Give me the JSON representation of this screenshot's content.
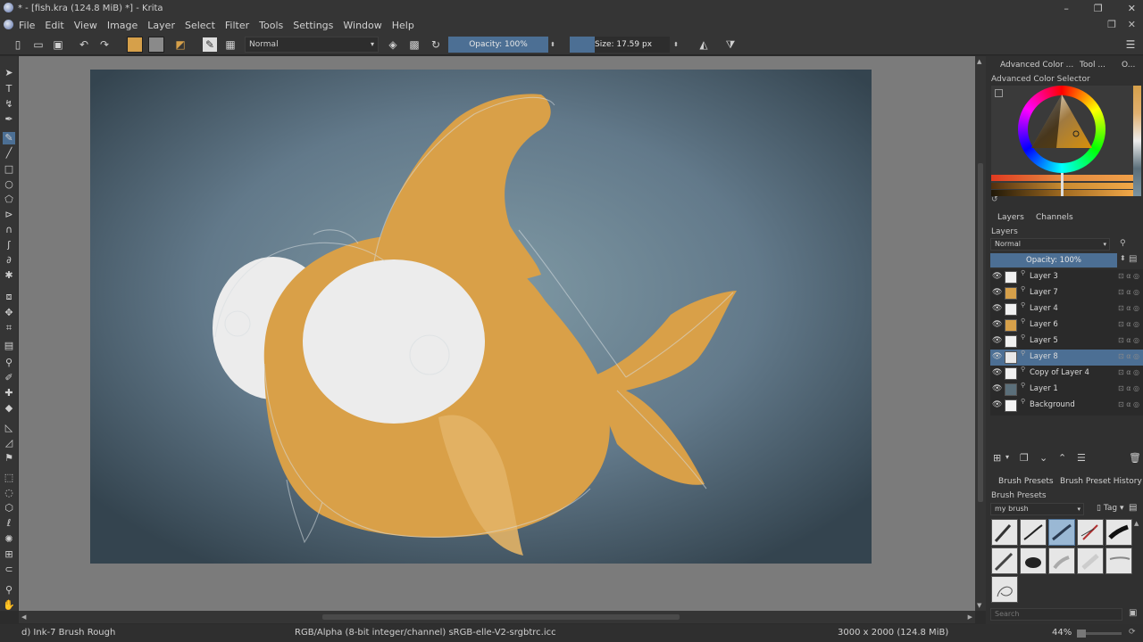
{
  "window": {
    "title": "* - [fish.kra (124.8 MiB) *] - Krita"
  },
  "menu": [
    "File",
    "Edit",
    "View",
    "Image",
    "Layer",
    "Select",
    "Filter",
    "Tools",
    "Settings",
    "Window",
    "Help"
  ],
  "toolbar": {
    "blend_mode": "Normal",
    "opacity_label": "Opacity: 100%",
    "size_label": "Size: 17.59 px",
    "fg_color": "#d6a04a",
    "bg_color": "#8a8a8a"
  },
  "dock": {
    "color_tabs": [
      "Advanced Color ...",
      "Tool ...",
      "O..."
    ],
    "color_selector_title": "Advanced Color Selector",
    "layer_tabs": [
      "Layers",
      "Channels"
    ],
    "layers_title": "Layers",
    "layers_blend": "Normal",
    "layers_opacity": "Opacity:  100%",
    "layers": [
      {
        "name": "Layer 3",
        "thumb": "#f0f0f0",
        "selected": false
      },
      {
        "name": "Layer 7",
        "thumb": "#d6a04a",
        "selected": false
      },
      {
        "name": "Layer 4",
        "thumb": "#f0f0f0",
        "selected": false
      },
      {
        "name": "Layer 6",
        "thumb": "#d6a04a",
        "selected": false
      },
      {
        "name": "Layer 5",
        "thumb": "#f0f0f0",
        "selected": false
      },
      {
        "name": "Layer 8",
        "thumb": "#e8e8e8",
        "selected": true
      },
      {
        "name": "Copy of Layer 4",
        "thumb": "#f0f0f0",
        "selected": false
      },
      {
        "name": "Layer 1",
        "thumb": "#5b6f7a",
        "selected": false
      },
      {
        "name": "Background",
        "thumb": "#f4f4f4",
        "selected": false
      }
    ],
    "brush_tabs": [
      "Brush Presets",
      "Brush Preset History"
    ],
    "brush_presets_title": "Brush Presets",
    "brush_tag": "my brush",
    "tag_label": "Tag",
    "search_placeholder": "Search"
  },
  "status": {
    "brush": "d) Ink-7 Brush Rough",
    "color_space": "RGB/Alpha (8-bit integer/channel)  sRGB-elle-V2-srgbtrc.icc",
    "dimensions": "3000 x 2000 (124.8 MiB)",
    "zoom": "44%"
  },
  "colors": {
    "accent": "#4c6f94",
    "fish": "#d9a048",
    "eye": "#ececec",
    "canvas_bg": "#6c8592"
  }
}
